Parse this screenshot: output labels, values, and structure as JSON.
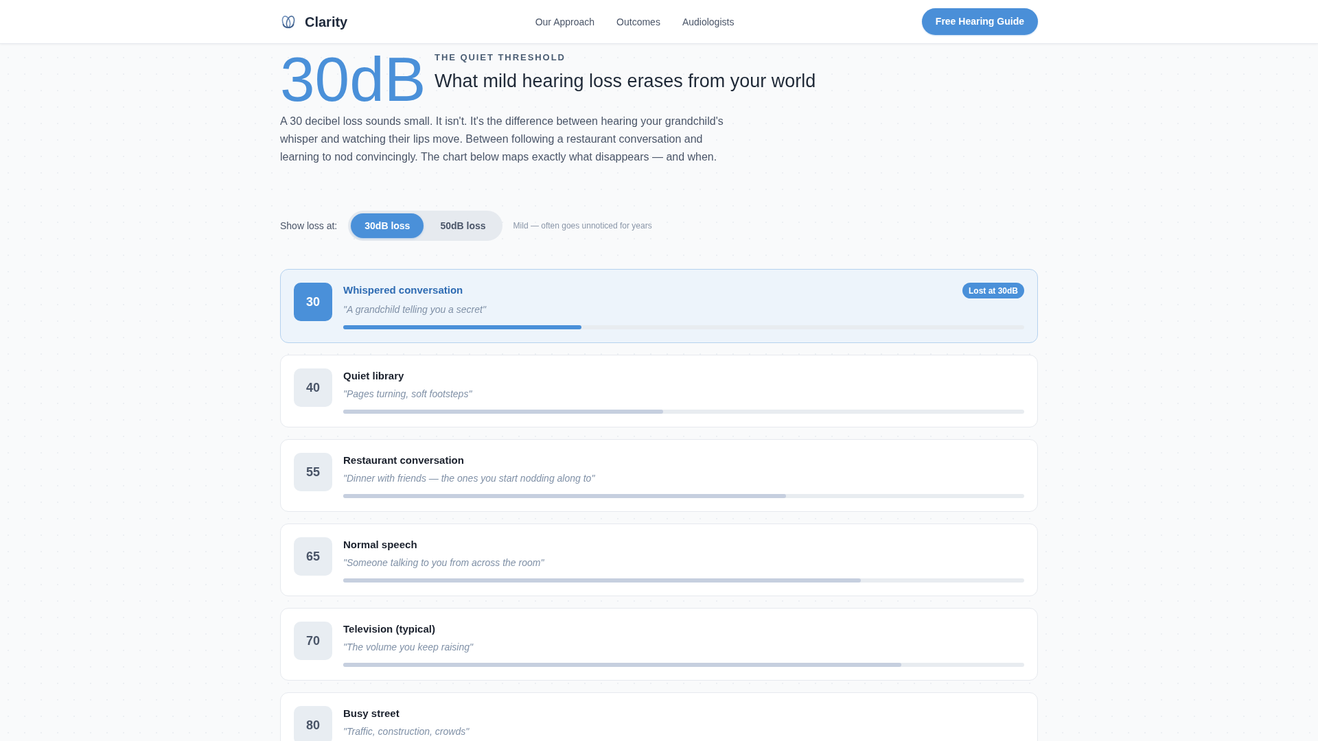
{
  "header": {
    "brand": "Clarity",
    "nav": [
      "Our Approach",
      "Outcomes",
      "Audiologists"
    ],
    "cta": "Free Hearing Guide"
  },
  "hero": {
    "big_number": "30dB",
    "eyebrow": "THE QUIET THRESHOLD",
    "title": "What mild hearing loss erases from your world",
    "intro": "A 30 decibel loss sounds small. It isn't. It's the difference between hearing your grandchild's whisper and watching their lips move. Between following a restaurant conversation and learning to nod convincingly. The chart below maps exactly what disappears — and when."
  },
  "loss_toggle": {
    "label": "Show loss at:",
    "options": [
      {
        "label": "30dB loss",
        "selected": true
      },
      {
        "label": "50dB loss",
        "selected": false
      }
    ],
    "hint": "Mild — often goes unnoticed for years"
  },
  "sounds": [
    {
      "decibels": "30",
      "name": "Whispered conversation",
      "example": "\"A grandchild telling you a secret\"",
      "lost": true,
      "badge": "Lost at 30dB",
      "level": 0.35
    },
    {
      "decibels": "40",
      "name": "Quiet library",
      "example": "\"Pages turning, soft footsteps\"",
      "lost": false,
      "level": 0.47
    },
    {
      "decibels": "55",
      "name": "Restaurant conversation",
      "example": "\"Dinner with friends — the ones you start nodding along to\"",
      "lost": false,
      "level": 0.65
    },
    {
      "decibels": "65",
      "name": "Normal speech",
      "example": "\"Someone talking to you from across the room\"",
      "lost": false,
      "level": 0.76
    },
    {
      "decibels": "70",
      "name": "Television (typical)",
      "example": "\"The volume you keep raising\"",
      "lost": false,
      "level": 0.82
    },
    {
      "decibels": "80",
      "name": "Busy street",
      "example": "\"Traffic, construction, crowds\"",
      "lost": false
    }
  ]
}
